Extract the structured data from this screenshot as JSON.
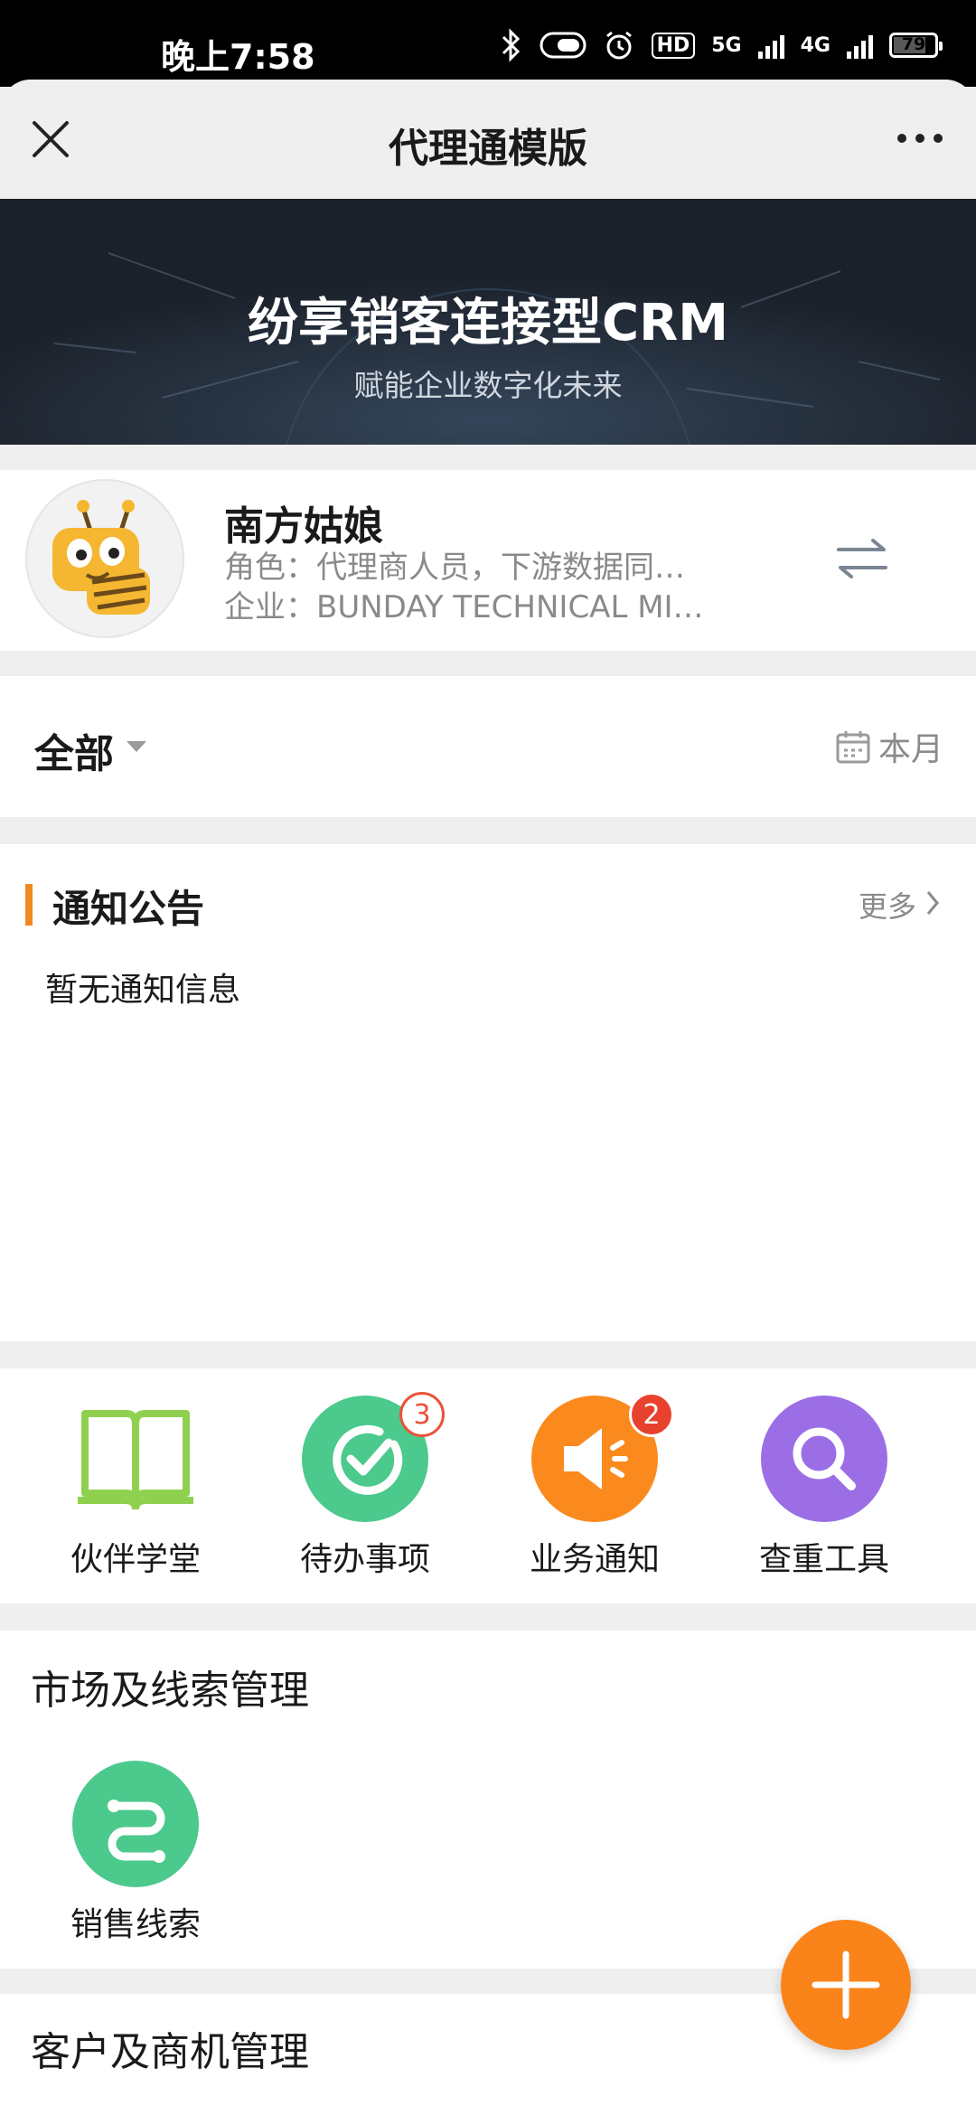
{
  "status_bar": {
    "time": "晚上7:58",
    "hd": "HD",
    "net1": "5G",
    "net2": "4G",
    "battery": "79",
    "battery_level": 0.79
  },
  "nav": {
    "title": "代理通模版"
  },
  "banner": {
    "title": "纷享销客连接型CRM",
    "subtitle": "赋能企业数字化未来"
  },
  "profile": {
    "name": "南方姑娘",
    "role": "角色：代理商人员，下游数据同…",
    "company": "企业：BUNDAY TECHNICAL MI…"
  },
  "filter": {
    "scope": "全部",
    "period": "本月"
  },
  "notice": {
    "title": "通知公告",
    "more": "更多",
    "empty": "暂无通知信息"
  },
  "quick_actions": [
    {
      "label": "伙伴学堂",
      "icon": "book-icon"
    },
    {
      "label": "待办事项",
      "icon": "check-circle-icon",
      "badge": "3",
      "color": "#4cc98c"
    },
    {
      "label": "业务通知",
      "icon": "megaphone-icon",
      "badge": "2",
      "color": "#fa8a1e"
    },
    {
      "label": "查重工具",
      "icon": "search-icon",
      "color": "#9b6ee6"
    }
  ],
  "sections": [
    {
      "title": "市场及线索管理",
      "items": [
        {
          "label": "销售线索",
          "icon": "leads-icon",
          "color": "#4cc98c"
        }
      ]
    },
    {
      "title": "客户及商机管理"
    }
  ],
  "colors": {
    "accent": "#fa8419",
    "green": "#4cc98c",
    "purple": "#9b6ee6",
    "book_green": "#8fd14f"
  }
}
